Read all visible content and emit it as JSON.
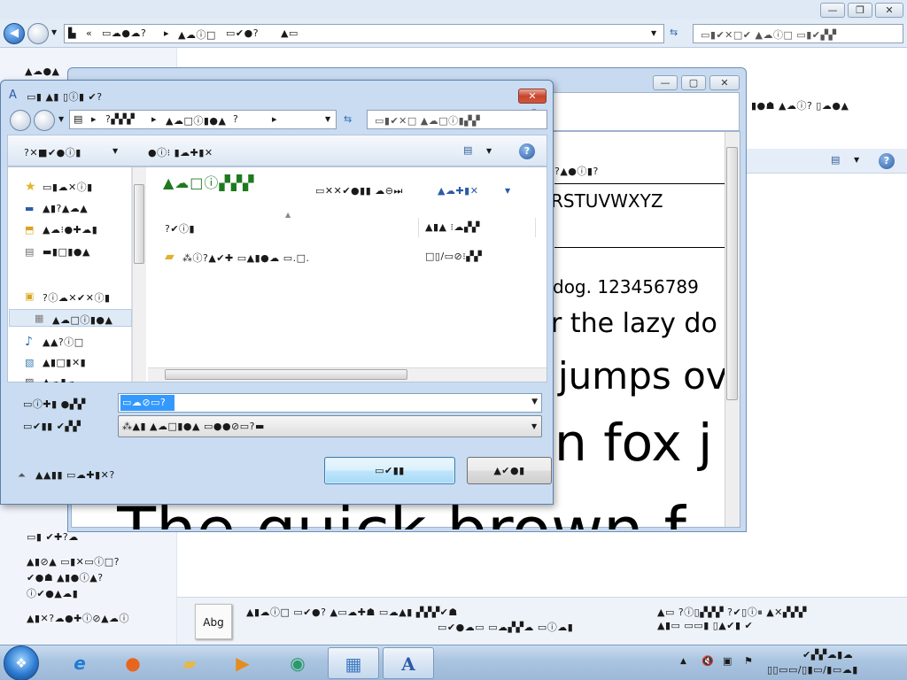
{
  "background_window": {
    "nav_back": "◀",
    "address_path": [
      "«",
      "▭☁●☁?",
      "▸",
      "▲☁ⓘ□",
      "▭✔●?",
      "▲▭"
    ],
    "search_placeholder": "▭▮✔✕□✔ ▲☁ⓘ□ ▭▮✔▞▞",
    "left_header": "▲☁●▲",
    "left_items": [
      "▭▮ ✔✚?☁",
      "▲▮⊘▲ ▭▮✕▭ⓘ□?",
      "✔●☗ ▲▮●ⓘ▲?",
      "ⓘ✔●▲☁▮",
      "▲▮✕?☁●✚ⓘ⊘▲☁ⓘ"
    ],
    "right_overflow_text": "▮●☗ ▲☁ⓘ? ▯☁●▲",
    "detail": {
      "icon_label": "Abg",
      "line1": "▲▮☁ⓘ□ ▭✔●? ▲▭☁✚☗ ▭☁▲▮ ▞▞▞✔☗",
      "line2": "▭✔●☁▭ ▭☁▞▞☁ ▭ⓘ☁▮",
      "right1": "▲▭ ?ⓘ▯▞▞▞ ?✔▯ⓘ⏸ ▲✕▞▞▞",
      "right2": "▲▮▭ ▭▭▮ ▯▲✔▮ ✔"
    }
  },
  "font_viewer": {
    "title_text": "▮ⓘ●▲☁ⓘ? ▯☁●▲",
    "header_text": "?▲●ⓘ▮?",
    "alphabet_line": "RSTUVWXYZ",
    "samples": [
      {
        "text": "dog. 123456789",
        "size": 20
      },
      {
        "text": "r the lazy do",
        "size": 30
      },
      {
        "text": "jumps ov",
        "size": 42
      },
      {
        "text": "n fox j",
        "size": 58
      },
      {
        "text": "The quick brown f",
        "size": 72
      }
    ]
  },
  "save_dialog": {
    "title": "▭▮ ▲▮ ▯ⓘ▮ ✔?",
    "nav_path": [
      "▸",
      "?▞▞▞",
      "▸",
      "▲☁□ⓘ▮●▲",
      "?",
      "▸"
    ],
    "search_placeholder": "▭▮✔✕□ ▲☁□ⓘ▮▞▞",
    "toolbar": {
      "organize": "?✕■✔●ⓘ▮",
      "new_folder": "●ⓘ⁝ ▮☁✚▮✕"
    },
    "tree_items": [
      {
        "icon": "★",
        "label": "▭▮☁✕ⓘ▮"
      },
      {
        "icon": "▬",
        "label": "▲▮?▲☁▲"
      },
      {
        "icon": "⬒",
        "label": "▲☁⁝●✚☁▮"
      },
      {
        "icon": "▤",
        "label": "▬▮□▮●▲"
      },
      {
        "icon": "▣",
        "label": "?ⓘ☁✕✔✕ⓘ▮"
      },
      {
        "icon": "▦",
        "label": "▲☁□ⓘ▮●▲"
      },
      {
        "icon": "♪",
        "label": "▲▲?ⓘ□"
      },
      {
        "icon": "▧",
        "label": "▲▮□▮✕▮"
      },
      {
        "icon": "▨",
        "label": "▲☁▮☁"
      }
    ],
    "library_title": "▲☁□ⓘ▞▞▞",
    "library_subtitle": "▭✕✕✔●▮▮ ☁⊖⏭",
    "arrange_label": "▲☁✚▮▮✕",
    "arrange_value": "▲☁✚▮✕",
    "columns": {
      "name": "?✔ⓘ▮",
      "date": "▲▮▲ ⁝☁▞▞",
      "type": "□▯/▯□⁝▞▞"
    },
    "file_row": {
      "name": "⁂ⓘ?▲✔✚ ▭▲▮●☁ ▭.□.",
      "date": "□▯/▭⊘⁝▞▞"
    },
    "filename_label": "▭ⓘ✚▮ ●▞▞",
    "filename_value": "▭☁⊘▭?",
    "filetype_label": "▭✔▮▮ ✔▞▞",
    "filetype_value": "⁂▲▮ ▲☁□▮●▲ ▭●●⊘▭?▬",
    "hide_folders": "▲▲▮▮ ▭☁✚▮✕?",
    "save_button": "▭✔▮▮",
    "cancel_button": "▲✔●▮"
  },
  "taskbar": {
    "start_glyph": "❖",
    "apps": [
      {
        "name": "internet-explorer",
        "glyph": "e",
        "color": "#1f7bd6"
      },
      {
        "name": "firefox",
        "glyph": "●",
        "color": "#e8651f"
      },
      {
        "name": "file-explorer",
        "glyph": "▰",
        "color": "#e4b84a"
      },
      {
        "name": "media-player",
        "glyph": "▶",
        "color": "#e58c1d"
      },
      {
        "name": "media-center",
        "glyph": "◉",
        "color": "#2a9a6a"
      },
      {
        "name": "control-panel",
        "glyph": "▦",
        "color": "#3d7bc2"
      },
      {
        "name": "font-viewer",
        "glyph": "A",
        "color": "#2c5aa8"
      }
    ],
    "tray": {
      "clock_time": "✔▞▞☁▮☁",
      "clock_date": "▯▯▭▭/▯▮▭/▮▭☁▮",
      "icons": [
        "▲",
        "🔇",
        "▣",
        "⚑"
      ]
    }
  }
}
